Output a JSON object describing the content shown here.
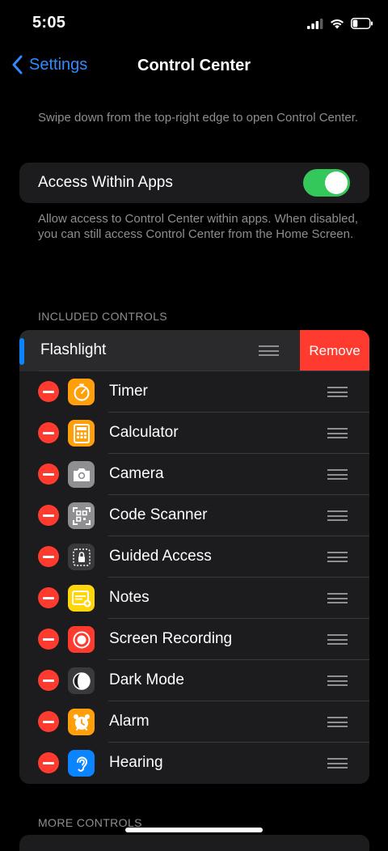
{
  "status_bar": {
    "time": "5:05",
    "battery_fraction": 0.3,
    "signal_bars_active": 3
  },
  "nav": {
    "back_label": "Settings",
    "title": "Control Center"
  },
  "intro_note": "Swipe down from the top-right edge to open Control Center.",
  "access": {
    "label": "Access Within Apps",
    "enabled": true,
    "footer": "Allow access to Control Center within apps. When disabled, you can still access Control Center from the Home Screen."
  },
  "included": {
    "header": "INCLUDED CONTROLS",
    "swiped_item": {
      "label": "Flashlight",
      "remove_label": "Remove"
    },
    "items": [
      {
        "label": "Timer",
        "icon": "timer-icon",
        "color": "#ff9f0a"
      },
      {
        "label": "Calculator",
        "icon": "calculator-icon",
        "color": "#ff9f0a"
      },
      {
        "label": "Camera",
        "icon": "camera-icon",
        "color": "#8e8e93"
      },
      {
        "label": "Code Scanner",
        "icon": "qr-code-icon",
        "color": "#8e8e93"
      },
      {
        "label": "Guided Access",
        "icon": "lock-icon",
        "color": "#3a3a3c"
      },
      {
        "label": "Notes",
        "icon": "notes-icon",
        "color": "#ffd60a"
      },
      {
        "label": "Screen Recording",
        "icon": "record-icon",
        "color": "#ff3b30"
      },
      {
        "label": "Dark Mode",
        "icon": "dark-mode-icon",
        "color": "#3a3a3c"
      },
      {
        "label": "Alarm",
        "icon": "alarm-icon",
        "color": "#ff9f0a"
      },
      {
        "label": "Hearing",
        "icon": "ear-icon",
        "color": "#0a84ff"
      }
    ]
  },
  "more": {
    "header": "MORE CONTROLS"
  },
  "colors": {
    "accent": "#2f8bff",
    "destructive": "#ff3b30",
    "toggle_on": "#34c759",
    "cell_background": "#1c1c1e"
  }
}
